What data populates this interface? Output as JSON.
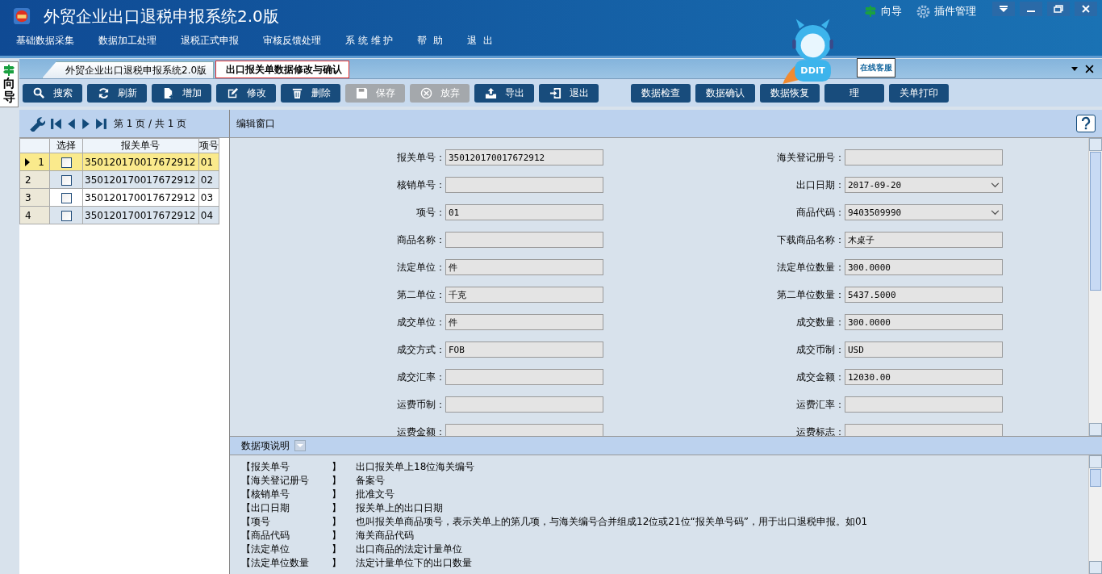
{
  "window": {
    "title": "外贸企业出口退税申报系统2.0版",
    "header_links": [
      {
        "kind": "guide",
        "label": "向导"
      },
      {
        "kind": "plugins",
        "label": "插件管理"
      }
    ]
  },
  "menu": [
    "基础数据采集",
    "数据加工处理",
    "退税正式申报",
    "审核反馈处理",
    "系 统 维 护",
    "帮  助",
    "退  出"
  ],
  "side_tab": {
    "label": "向导"
  },
  "tabs": [
    {
      "label": "外贸企业出口退税申报系统2.0版",
      "selected": false
    },
    {
      "label": "出口报关单数据修改与确认",
      "selected": true
    }
  ],
  "mascot": {
    "sign": "在线客服",
    "badge": "DDIT"
  },
  "toolbar": [
    {
      "kind": "search",
      "label": "搜索",
      "disabled": false
    },
    {
      "kind": "refresh",
      "label": "刷新",
      "disabled": false
    },
    {
      "kind": "add",
      "label": "增加",
      "disabled": false
    },
    {
      "kind": "edit",
      "label": "修改",
      "disabled": false
    },
    {
      "kind": "delete",
      "label": "删除",
      "disabled": false
    },
    {
      "kind": "save",
      "label": "保存",
      "disabled": true
    },
    {
      "kind": "cancel",
      "label": "放弃",
      "disabled": true
    },
    {
      "kind": "export",
      "label": "导出",
      "disabled": false
    },
    {
      "kind": "exit",
      "label": "退出",
      "disabled": false
    },
    {
      "kind": "gap"
    },
    {
      "kind": "text",
      "label": "数据检查",
      "disabled": false
    },
    {
      "kind": "text",
      "label": "数据确认",
      "disabled": false
    },
    {
      "kind": "text",
      "label": "数据恢复",
      "disabled": false
    },
    {
      "kind": "text",
      "label": "理",
      "disabled": false
    },
    {
      "kind": "text",
      "label": "关单打印",
      "disabled": false
    }
  ],
  "pager": {
    "text": "第 1 页 / 共 1 页"
  },
  "grid": {
    "columns": [
      "选择",
      "报关单号",
      "项号"
    ],
    "rows": [
      {
        "index": "1",
        "checked": false,
        "selected": true,
        "number": "350120170017672912",
        "item": "01"
      },
      {
        "index": "2",
        "checked": false,
        "selected": false,
        "number": "350120170017672912",
        "item": "02"
      },
      {
        "index": "3",
        "checked": false,
        "selected": false,
        "number": "350120170017672912",
        "item": "03"
      },
      {
        "index": "4",
        "checked": false,
        "selected": false,
        "number": "350120170017672912",
        "item": "04"
      }
    ]
  },
  "editor": {
    "title": "编辑窗口",
    "fields": [
      {
        "label": "报关单号：",
        "value": "350120170017672912",
        "kind": "text"
      },
      {
        "label": "海关登记册号：",
        "kind": "text"
      },
      {
        "label": "核销单号：",
        "kind": "text"
      },
      {
        "label": "出口日期：",
        "value": "2017-09-20",
        "kind": "select"
      },
      {
        "label": "项号：",
        "value": "01",
        "kind": "text"
      },
      {
        "label": "商品代码：",
        "value": "9403509990",
        "kind": "select"
      },
      {
        "label": "商品名称：",
        "kind": "text"
      },
      {
        "label": "下载商品名称：",
        "value": "木桌子",
        "kind": "text"
      },
      {
        "label": "法定单位：",
        "value": "件",
        "kind": "text"
      },
      {
        "label": "法定单位数量：",
        "value": "300.0000",
        "kind": "text"
      },
      {
        "label": "第二单位：",
        "value": "千克",
        "kind": "text"
      },
      {
        "label": "第二单位数量：",
        "value": "5437.5000",
        "kind": "text"
      },
      {
        "label": "成交单位：",
        "value": "件",
        "kind": "text"
      },
      {
        "label": "成交数量：",
        "value": "300.0000",
        "kind": "text"
      },
      {
        "label": "成交方式：",
        "value": "FOB",
        "kind": "text"
      },
      {
        "label": "成交币制：",
        "value": "USD",
        "kind": "text"
      },
      {
        "label": "成交汇率：",
        "kind": "text"
      },
      {
        "label": "成交金额：",
        "value": "12030.00",
        "kind": "text"
      },
      {
        "label": "运费币制：",
        "kind": "text"
      },
      {
        "label": "运费汇率：",
        "kind": "text"
      },
      {
        "label": "运费金额：",
        "kind": "text"
      },
      {
        "label": "运费标志：",
        "kind": "text"
      }
    ]
  },
  "help": {
    "title": "数据项说明",
    "items": [
      {
        "term": "【报关单号",
        "close": "】",
        "text": "出口报关单上18位海关编号"
      },
      {
        "term": "【海关登记册号",
        "close": "】",
        "text": "备案号"
      },
      {
        "term": "【核销单号",
        "close": "】",
        "text": "批准文号"
      },
      {
        "term": "【出口日期",
        "close": "】",
        "text": "报关单上的出口日期"
      },
      {
        "term": "【项号",
        "close": "】",
        "text": "也叫报关单商品项号，表示关单上的第几项，与海关编号合并组成12位或21位“报关单号码”，用于出口退税申报。如01"
      },
      {
        "term": "【商品代码",
        "close": "】",
        "text": "海关商品代码"
      },
      {
        "term": "【法定单位",
        "close": "】",
        "text": "出口商品的法定计量单位"
      },
      {
        "term": "【法定单位数量",
        "close": "】",
        "text": "法定计量单位下的出口数量"
      }
    ]
  }
}
